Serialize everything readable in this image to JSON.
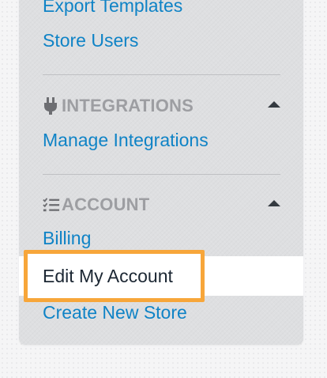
{
  "sidebar": {
    "top_links": [
      {
        "label": "Export Templates"
      },
      {
        "label": "Store Users"
      }
    ],
    "integrations": {
      "icon": "plug-icon",
      "title": "INTEGRATIONS",
      "collapse_icon": "caret-up-icon",
      "items": [
        {
          "label": "Manage Integrations"
        }
      ]
    },
    "account": {
      "icon": "checklist-icon",
      "title": "ACCOUNT",
      "collapse_icon": "caret-up-icon",
      "items": [
        {
          "label": "Billing"
        },
        {
          "label": "Edit My Account",
          "active": true
        },
        {
          "label": "Create New Store"
        }
      ]
    }
  },
  "colors": {
    "link": "#0f83c6",
    "header_text": "#9d9ea2",
    "panel_bg": "#dedfe1",
    "highlight_border": "#f7a63a",
    "active_text": "#1c2733"
  }
}
